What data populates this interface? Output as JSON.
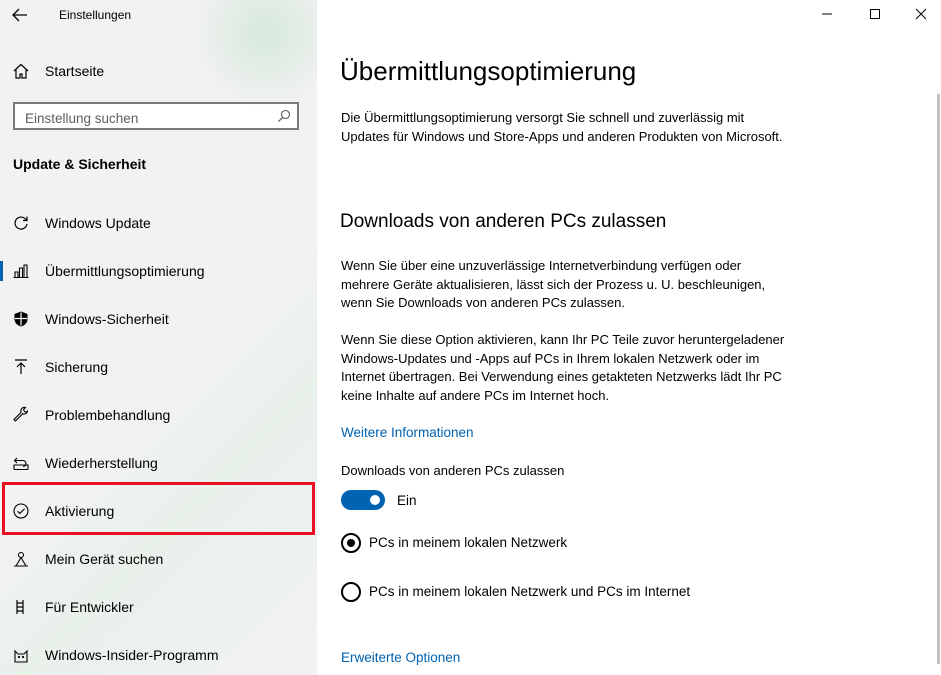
{
  "window": {
    "title": "Einstellungen"
  },
  "sidebar": {
    "home_label": "Startseite",
    "search_placeholder": "Einstellung suchen",
    "section_title": "Update & Sicherheit",
    "items": [
      {
        "label": "Windows Update",
        "icon": "refresh-icon"
      },
      {
        "label": "Übermittlungsoptimierung",
        "icon": "delivery-optimization-icon",
        "selected": true
      },
      {
        "label": "Windows-Sicherheit",
        "icon": "shield-icon"
      },
      {
        "label": "Sicherung",
        "icon": "backup-arrow-icon"
      },
      {
        "label": "Problembehandlung",
        "icon": "wrench-icon"
      },
      {
        "label": "Wiederherstellung",
        "icon": "recovery-icon"
      },
      {
        "label": "Aktivierung",
        "icon": "check-circle-icon",
        "highlighted": true
      },
      {
        "label": "Mein Gerät suchen",
        "icon": "find-device-icon"
      },
      {
        "label": "Für Entwickler",
        "icon": "developer-icon"
      },
      {
        "label": "Windows-Insider-Programm",
        "icon": "insider-cat-icon"
      }
    ]
  },
  "main": {
    "title": "Übermittlungsoptimierung",
    "intro": "Die Übermittlungsoptimierung versorgt Sie schnell und zuverlässig mit Updates für Windows und Store-Apps und anderen Produkten von Microsoft.",
    "section_heading": "Downloads von anderen PCs zulassen",
    "para1": "Wenn Sie über eine unzuverlässige Internetverbindung verfügen oder mehrere Geräte aktualisieren, lässt sich der Prozess u. U. beschleunigen, wenn Sie Downloads von anderen PCs zulassen.",
    "para2": "Wenn Sie diese Option aktivieren, kann Ihr PC Teile zuvor heruntergeladener Windows-Updates und -Apps auf PCs in Ihrem lokalen Netzwerk oder im Internet übertragen. Bei Verwendung eines getakteten Netzwerks lädt Ihr PC keine Inhalte auf andere PCs im Internet hoch.",
    "more_info_link": "Weitere Informationen",
    "toggle_caption": "Downloads von anderen PCs zulassen",
    "toggle_state": "Ein",
    "radio_local": "PCs in meinem lokalen Netzwerk",
    "radio_internet": "PCs in meinem lokalen Netzwerk und PCs im Internet",
    "advanced_link": "Erweiterte Optionen"
  },
  "colors": {
    "accent": "#0063b1",
    "highlight": "#e81123"
  }
}
